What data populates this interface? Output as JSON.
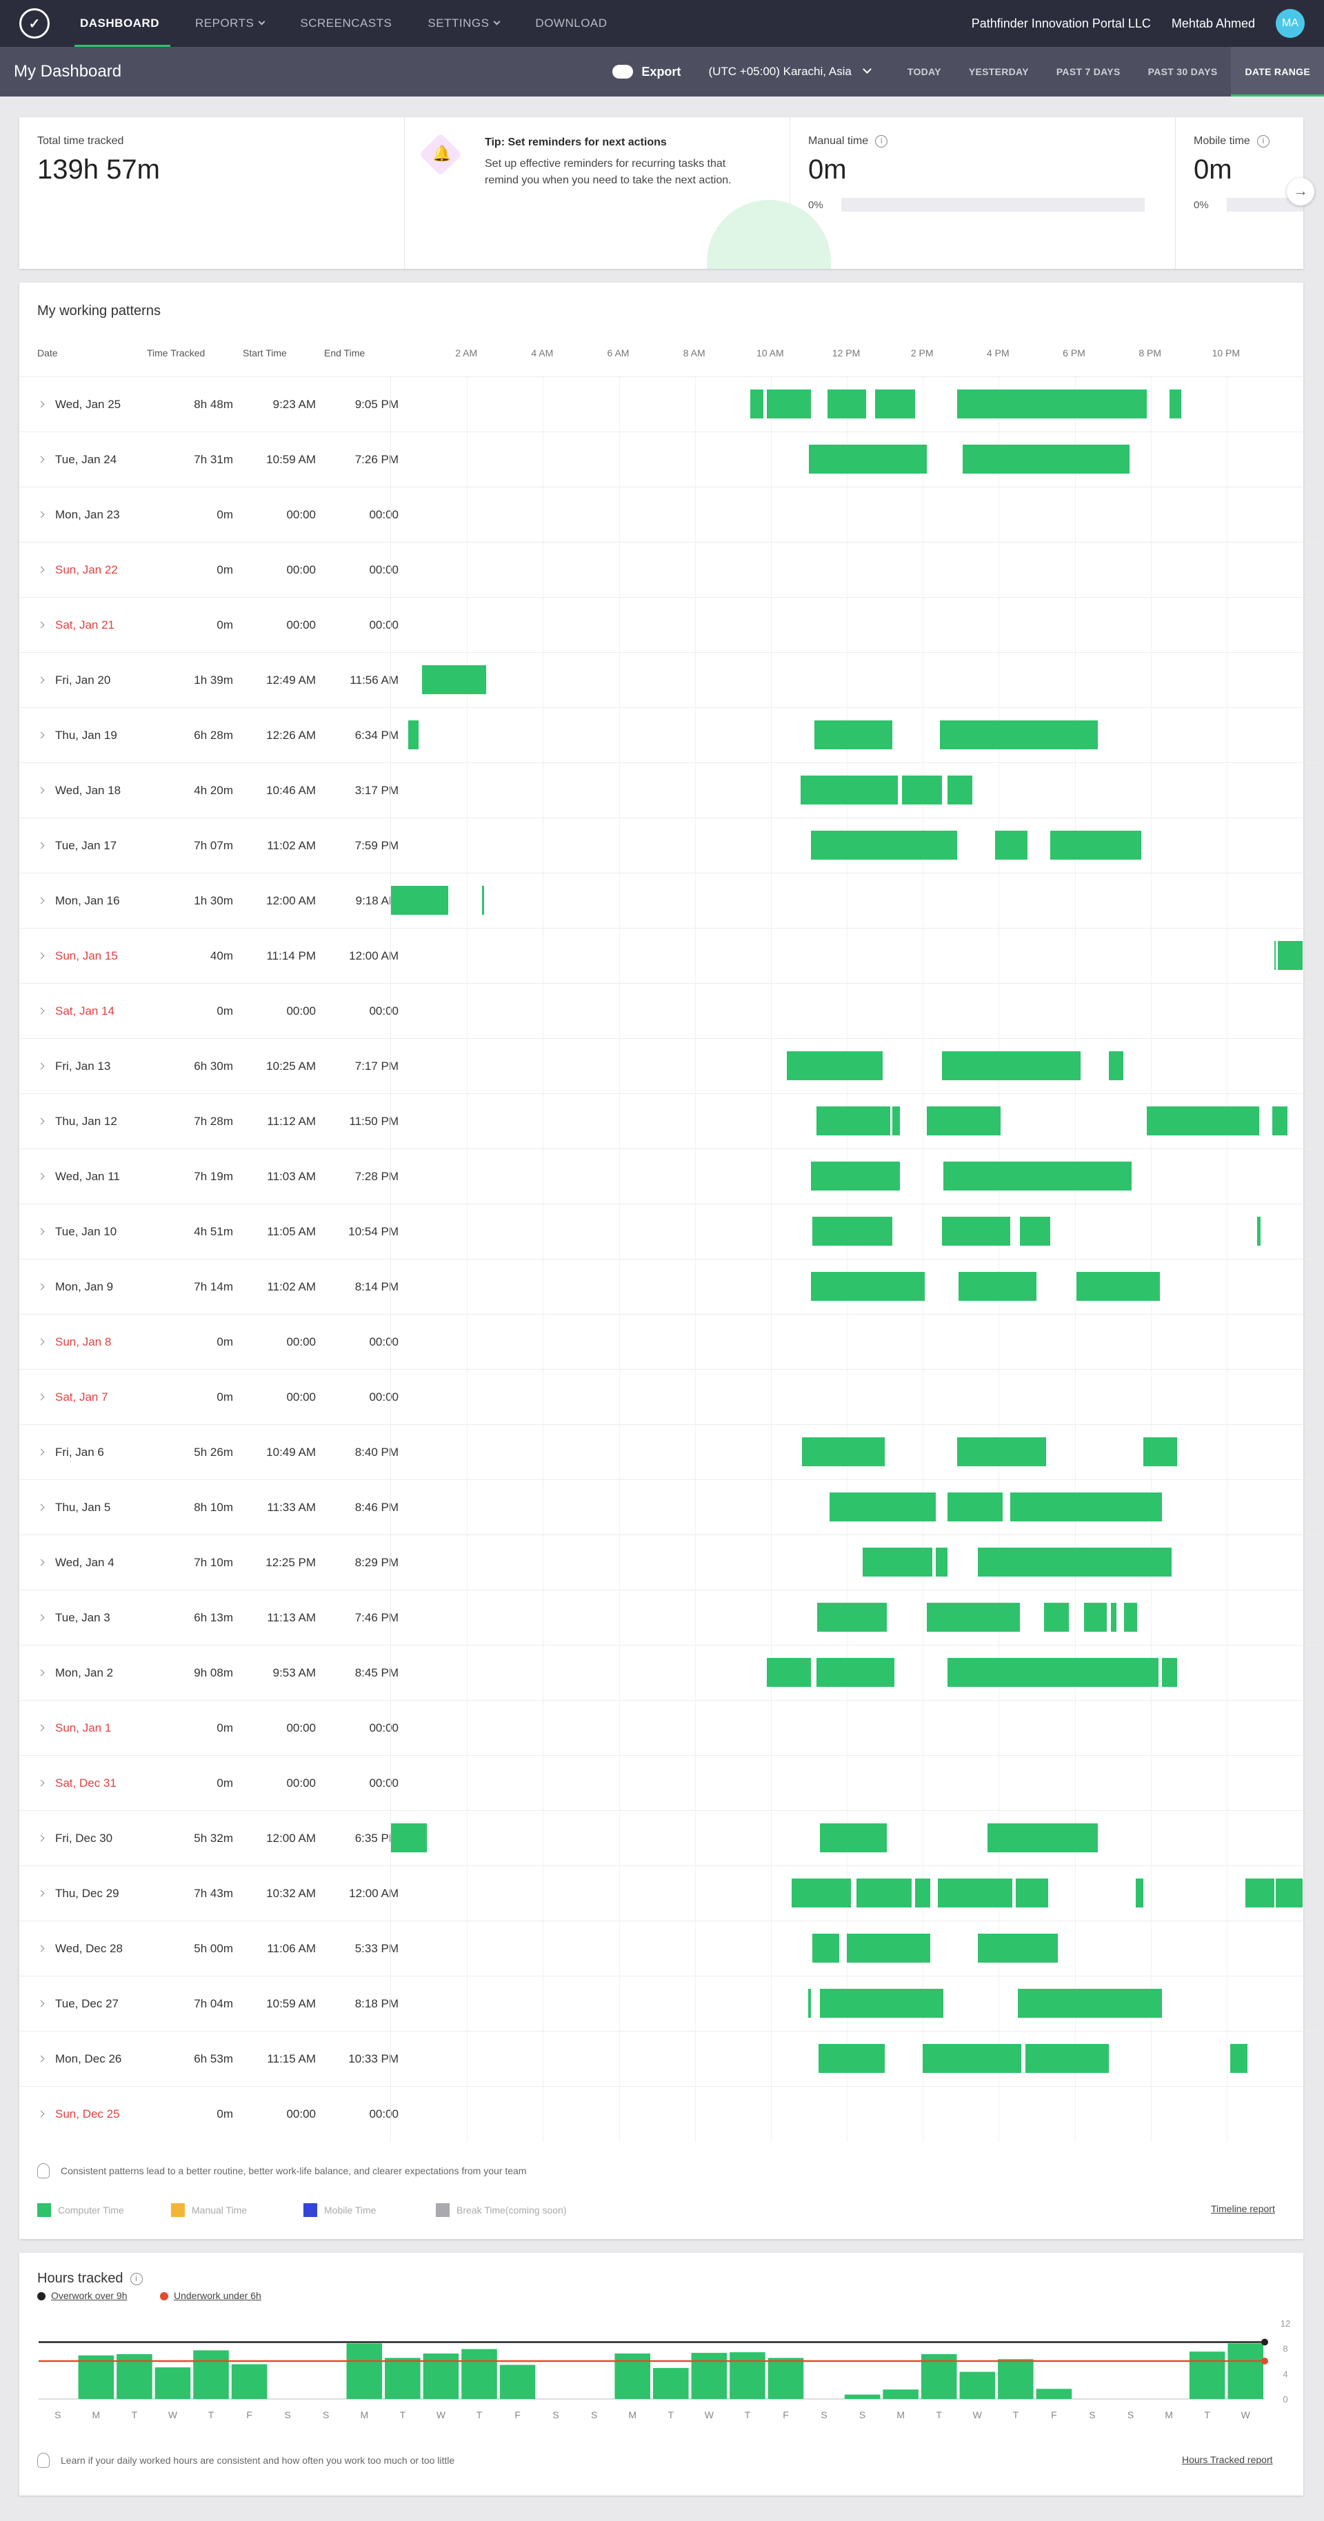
{
  "nav": {
    "brand": "✓",
    "items": [
      "DASHBOARD",
      "REPORTS",
      "SCREENCASTS",
      "SETTINGS",
      "DOWNLOAD"
    ],
    "active": 0,
    "dropdown": [
      1,
      3
    ],
    "org": "Pathfinder Innovation Portal LLC",
    "user": "Mehtab Ahmed",
    "initials": "MA"
  },
  "subbar": {
    "title": "My Dashboard",
    "export": "Export",
    "timezone": "(UTC +05:00) Karachi, Asia",
    "ranges": [
      "TODAY",
      "YESTERDAY",
      "PAST 7 DAYS",
      "PAST 30 DAYS",
      "DATE RANGE"
    ],
    "active_range": 4
  },
  "summary": {
    "total_label": "Total time tracked",
    "total_value": "139h 57m",
    "tip_title": "Tip: Set reminders for next actions",
    "tip_text": "Set up effective reminders for recurring tasks that remind you when you need to take the next action.",
    "manual_label": "Manual time",
    "manual_value": "0m",
    "manual_pct": "0%",
    "mobile_label": "Mobile time",
    "mobile_value": "0m",
    "mobile_pct": "0%"
  },
  "patterns": {
    "title": "My working patterns",
    "headers": [
      "Date",
      "Time Tracked",
      "Start Time",
      "End Time"
    ],
    "hours": [
      "2 AM",
      "4 AM",
      "6 AM",
      "8 AM",
      "10 AM",
      "12 PM",
      "2 PM",
      "4 PM",
      "6 PM",
      "8 PM",
      "10 PM"
    ],
    "rows": [
      {
        "date": "Wed, Jan 25",
        "tracked": "8h 48m",
        "start": "9:23 AM",
        "end": "9:05 PM",
        "weekend": false,
        "segs": [
          [
            9.45,
            9.8
          ],
          [
            9.9,
            11.05
          ],
          [
            11.5,
            12.5
          ],
          [
            12.75,
            13.8
          ],
          [
            14.9,
            19.9
          ],
          [
            20.5,
            20.8
          ]
        ]
      },
      {
        "date": "Tue, Jan 24",
        "tracked": "7h 31m",
        "start": "10:59 AM",
        "end": "7:26 PM",
        "weekend": false,
        "segs": [
          [
            11.0,
            14.1
          ],
          [
            15.05,
            19.45
          ]
        ]
      },
      {
        "date": "Mon, Jan 23",
        "tracked": "0m",
        "start": "00:00",
        "end": "00:00",
        "weekend": false,
        "segs": []
      },
      {
        "date": "Sun, Jan 22",
        "tracked": "0m",
        "start": "00:00",
        "end": "00:00",
        "weekend": true,
        "segs": []
      },
      {
        "date": "Sat, Jan 21",
        "tracked": "0m",
        "start": "00:00",
        "end": "00:00",
        "weekend": true,
        "segs": []
      },
      {
        "date": "Fri, Jan 20",
        "tracked": "1h 39m",
        "start": "12:49 AM",
        "end": "11:56 AM",
        "weekend": false,
        "segs": [
          [
            0.82,
            2.5
          ]
        ]
      },
      {
        "date": "Thu, Jan 19",
        "tracked": "6h 28m",
        "start": "12:26 AM",
        "end": "6:34 PM",
        "weekend": false,
        "segs": [
          [
            0.45,
            0.72
          ],
          [
            11.15,
            13.2
          ],
          [
            14.45,
            18.6
          ]
        ]
      },
      {
        "date": "Wed, Jan 18",
        "tracked": "4h 20m",
        "start": "10:46 AM",
        "end": "3:17 PM",
        "weekend": false,
        "segs": [
          [
            10.78,
            13.35
          ],
          [
            13.45,
            14.5
          ],
          [
            14.65,
            15.3
          ]
        ]
      },
      {
        "date": "Tue, Jan 17",
        "tracked": "7h 07m",
        "start": "11:02 AM",
        "end": "7:59 PM",
        "weekend": false,
        "segs": [
          [
            11.05,
            14.9
          ],
          [
            15.9,
            16.75
          ],
          [
            17.35,
            19.75
          ]
        ]
      },
      {
        "date": "Mon, Jan 16",
        "tracked": "1h 30m",
        "start": "12:00 AM",
        "end": "9:18 AM",
        "weekend": false,
        "segs": [
          [
            0.0,
            1.5
          ],
          [
            2.4,
            2.45
          ]
        ]
      },
      {
        "date": "Sun, Jan 15",
        "tracked": "40m",
        "start": "11:14 PM",
        "end": "12:00 AM",
        "weekend": true,
        "segs": [
          [
            23.25,
            23.3
          ],
          [
            23.35,
            24.0
          ]
        ]
      },
      {
        "date": "Sat, Jan 14",
        "tracked": "0m",
        "start": "00:00",
        "end": "00:00",
        "weekend": true,
        "segs": []
      },
      {
        "date": "Fri, Jan 13",
        "tracked": "6h 30m",
        "start": "10:25 AM",
        "end": "7:17 PM",
        "weekend": false,
        "segs": [
          [
            10.42,
            12.95
          ],
          [
            14.5,
            18.15
          ],
          [
            18.9,
            19.28
          ]
        ]
      },
      {
        "date": "Thu, Jan 12",
        "tracked": "7h 28m",
        "start": "11:12 AM",
        "end": "11:50 PM",
        "weekend": false,
        "segs": [
          [
            11.2,
            13.15
          ],
          [
            13.2,
            13.4
          ],
          [
            14.1,
            16.05
          ],
          [
            19.9,
            22.85
          ],
          [
            23.2,
            23.6
          ]
        ]
      },
      {
        "date": "Wed, Jan 11",
        "tracked": "7h 19m",
        "start": "11:03 AM",
        "end": "7:28 PM",
        "weekend": false,
        "segs": [
          [
            11.05,
            13.4
          ],
          [
            14.55,
            19.5
          ]
        ]
      },
      {
        "date": "Tue, Jan 10",
        "tracked": "4h 51m",
        "start": "11:05 AM",
        "end": "10:54 PM",
        "weekend": false,
        "segs": [
          [
            11.1,
            13.2
          ],
          [
            14.5,
            16.3
          ],
          [
            16.55,
            17.35
          ],
          [
            22.8,
            22.9
          ]
        ]
      },
      {
        "date": "Mon, Jan 9",
        "tracked": "7h 14m",
        "start": "11:02 AM",
        "end": "8:14 PM",
        "weekend": false,
        "segs": [
          [
            11.05,
            14.05
          ],
          [
            14.95,
            17.0
          ],
          [
            18.05,
            20.25
          ]
        ]
      },
      {
        "date": "Sun, Jan 8",
        "tracked": "0m",
        "start": "00:00",
        "end": "00:00",
        "weekend": true,
        "segs": []
      },
      {
        "date": "Sat, Jan 7",
        "tracked": "0m",
        "start": "00:00",
        "end": "00:00",
        "weekend": true,
        "segs": []
      },
      {
        "date": "Fri, Jan 6",
        "tracked": "5h 26m",
        "start": "10:49 AM",
        "end": "8:40 PM",
        "weekend": false,
        "segs": [
          [
            10.82,
            13.0
          ],
          [
            14.9,
            17.25
          ],
          [
            19.8,
            20.7
          ]
        ]
      },
      {
        "date": "Thu, Jan 5",
        "tracked": "8h 10m",
        "start": "11:33 AM",
        "end": "8:46 PM",
        "weekend": false,
        "segs": [
          [
            11.55,
            14.35
          ],
          [
            14.65,
            16.1
          ],
          [
            16.3,
            20.3
          ]
        ]
      },
      {
        "date": "Wed, Jan 4",
        "tracked": "7h 10m",
        "start": "12:25 PM",
        "end": "8:29 PM",
        "weekend": false,
        "segs": [
          [
            12.42,
            14.25
          ],
          [
            14.35,
            14.65
          ],
          [
            15.45,
            20.55
          ]
        ]
      },
      {
        "date": "Tue, Jan 3",
        "tracked": "6h 13m",
        "start": "11:13 AM",
        "end": "7:46 PM",
        "weekend": false,
        "segs": [
          [
            11.22,
            13.05
          ],
          [
            14.1,
            16.55
          ],
          [
            17.2,
            17.85
          ],
          [
            18.25,
            18.85
          ],
          [
            18.95,
            19.1
          ],
          [
            19.3,
            19.65
          ]
        ]
      },
      {
        "date": "Mon, Jan 2",
        "tracked": "9h 08m",
        "start": "9:53 AM",
        "end": "8:45 PM",
        "weekend": false,
        "segs": [
          [
            9.9,
            11.05
          ],
          [
            11.2,
            13.25
          ],
          [
            14.65,
            20.2
          ],
          [
            20.3,
            20.7
          ]
        ]
      },
      {
        "date": "Sun, Jan 1",
        "tracked": "0m",
        "start": "00:00",
        "end": "00:00",
        "weekend": true,
        "segs": []
      },
      {
        "date": "Sat, Dec 31",
        "tracked": "0m",
        "start": "00:00",
        "end": "00:00",
        "weekend": true,
        "segs": []
      },
      {
        "date": "Fri, Dec 30",
        "tracked": "5h 32m",
        "start": "12:00 AM",
        "end": "6:35 PM",
        "weekend": false,
        "segs": [
          [
            0.0,
            0.95
          ],
          [
            11.3,
            13.05
          ],
          [
            15.7,
            18.6
          ]
        ]
      },
      {
        "date": "Thu, Dec 29",
        "tracked": "7h 43m",
        "start": "10:32 AM",
        "end": "12:00 AM",
        "weekend": false,
        "segs": [
          [
            10.55,
            12.1
          ],
          [
            12.25,
            13.7
          ],
          [
            13.8,
            14.2
          ],
          [
            14.4,
            16.35
          ],
          [
            16.45,
            17.3
          ],
          [
            19.6,
            19.8
          ],
          [
            22.5,
            23.25
          ],
          [
            23.3,
            24.0
          ]
        ]
      },
      {
        "date": "Wed, Dec 28",
        "tracked": "5h 00m",
        "start": "11:06 AM",
        "end": "5:33 PM",
        "weekend": false,
        "segs": [
          [
            11.1,
            11.8
          ],
          [
            12.0,
            14.2
          ],
          [
            15.45,
            17.55
          ]
        ]
      },
      {
        "date": "Tue, Dec 27",
        "tracked": "7h 04m",
        "start": "10:59 AM",
        "end": "8:18 PM",
        "weekend": false,
        "segs": [
          [
            10.98,
            11.05
          ],
          [
            11.3,
            14.55
          ],
          [
            16.5,
            20.3
          ]
        ]
      },
      {
        "date": "Mon, Dec 26",
        "tracked": "6h 53m",
        "start": "11:15 AM",
        "end": "10:33 PM",
        "weekend": false,
        "segs": [
          [
            11.25,
            13.0
          ],
          [
            14.0,
            16.6
          ],
          [
            16.7,
            18.9
          ],
          [
            22.1,
            22.55
          ]
        ]
      },
      {
        "date": "Sun, Dec 25",
        "tracked": "0m",
        "start": "00:00",
        "end": "00:00",
        "weekend": true,
        "segs": []
      }
    ],
    "note": "Consistent patterns lead to a better routine, better work-life balance, and clearer expectations from your team",
    "legend": [
      {
        "label": "Computer Time",
        "color": "#2ec26b"
      },
      {
        "label": "Manual Time",
        "color": "#f5b534"
      },
      {
        "label": "Mobile Time",
        "color": "#3245d6"
      },
      {
        "label": "Break Time(coming soon)",
        "color": "#a9a9ae"
      }
    ],
    "report_link": "Timeline report"
  },
  "hours": {
    "title": "Hours tracked",
    "overwork": "Overwork over 9h",
    "underwork": "Underwork under 6h",
    "note": "Learn if your daily worked hours are consistent and how often you work too much or too little",
    "report_link": "Hours Tracked report",
    "chart_data": {
      "type": "bar",
      "thresholds": {
        "overwork": 9,
        "underwork": 6
      },
      "colors": {
        "bar": "#2ec26b",
        "overwork": "#222222",
        "underwork": "#e34a30"
      },
      "ylim": [
        0,
        12
      ],
      "yticks": [
        "12",
        "8",
        "4",
        "0"
      ],
      "days": [
        "S",
        "M",
        "T",
        "W",
        "T",
        "F",
        "S",
        "S",
        "M",
        "T",
        "W",
        "T",
        "F",
        "S",
        "S",
        "M",
        "T",
        "W",
        "T",
        "F",
        "S",
        "S",
        "M",
        "T",
        "W",
        "T",
        "F",
        "S",
        "S",
        "M",
        "T",
        "W"
      ],
      "values": [
        0,
        6.9,
        7.1,
        5.0,
        7.7,
        5.5,
        0,
        0,
        8.8,
        6.5,
        7.2,
        7.9,
        5.4,
        0,
        0,
        7.2,
        4.9,
        7.3,
        7.4,
        6.5,
        0,
        0.7,
        1.5,
        7.1,
        4.3,
        6.3,
        1.6,
        0,
        0,
        0,
        7.5,
        8.8
      ]
    }
  }
}
